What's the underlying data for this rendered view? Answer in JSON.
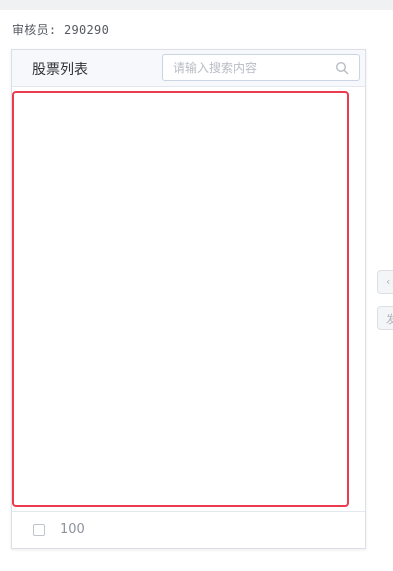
{
  "reviewer_label": "审核员: 290290",
  "panel": {
    "title": "股票列表",
    "search": {
      "value": "",
      "placeholder": "请输入搜索内容",
      "icon": "search-icon"
    },
    "footer": {
      "count": "100",
      "checked": false
    }
  },
  "side_buttons": [
    {
      "icon": "chevron-left-icon",
      "glyph": "‹"
    },
    {
      "icon": "arrow-right-icon",
      "glyph": "发"
    }
  ],
  "colors": {
    "highlight_border": "#ec3a4f",
    "panel_border": "#dcdfe6",
    "header_bg": "#f6f8fb"
  }
}
